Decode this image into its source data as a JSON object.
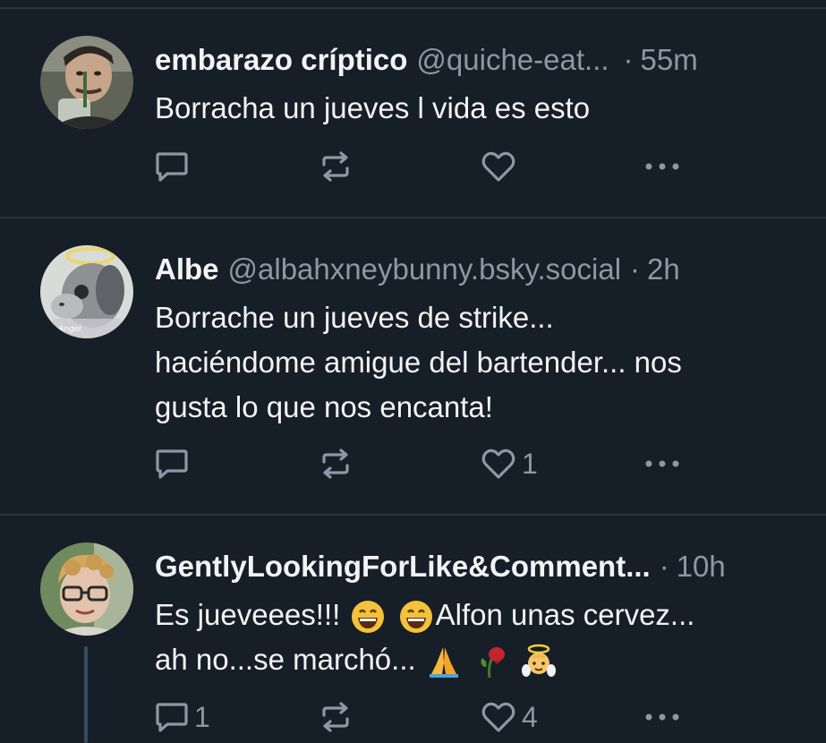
{
  "posts": [
    {
      "display_name": "embarazo críptico",
      "handle": "@quiche-eat...",
      "separator": "·",
      "time": "55m",
      "text": "Borracha un jueves l vida es esto",
      "reply_count": "",
      "repost_count": "",
      "like_count": ""
    },
    {
      "display_name": "Albe",
      "handle": "@albahxneybunny.bsky.social",
      "separator": "·",
      "time": "2h",
      "text_lines": [
        "Borrache un jueves de strike...",
        "haciéndome amigue del bartender... nos",
        "gusta lo que nos encanta!"
      ],
      "reply_count": "",
      "repost_count": "",
      "like_count": "1"
    },
    {
      "display_name": "GentlyLookingForLike&Comment...",
      "separator": "·",
      "time": "10h",
      "text_line1_a": "Es jueveees!!!",
      "text_line1_b": "Alfon unas cervez...",
      "text_line2": "ah no...se marchó...",
      "reply_count": "1",
      "repost_count": "",
      "like_count": "4"
    }
  ],
  "icons": {
    "reply": "reply-icon",
    "repost": "repost-icon",
    "like": "heart-icon",
    "more": "more-icon"
  },
  "colors": {
    "background": "#161e27",
    "divider": "#2b3642",
    "muted": "#8b98a5",
    "text": "#f1f3f5"
  }
}
